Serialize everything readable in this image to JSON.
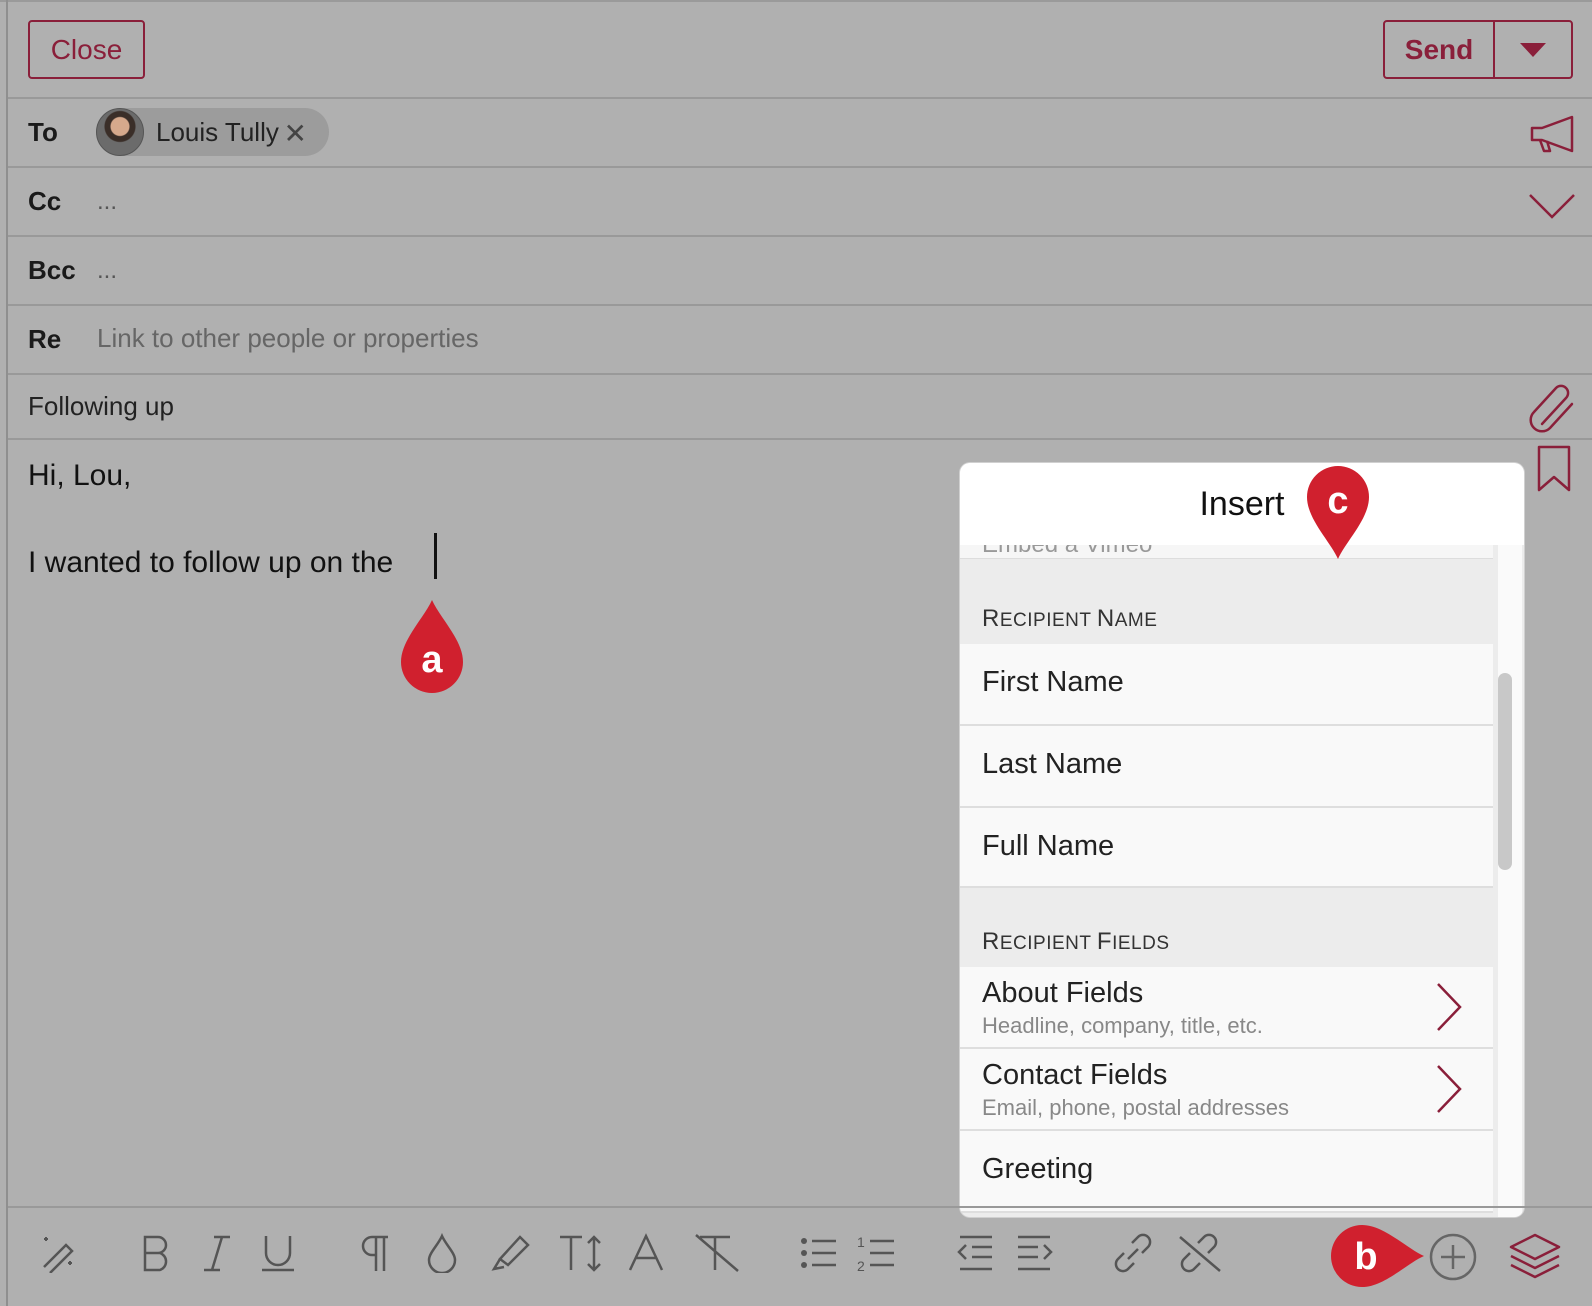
{
  "header": {
    "close_label": "Close",
    "send_label": "Send"
  },
  "fields": {
    "to_label": "To",
    "cc_label": "Cc",
    "bcc_label": "Bcc",
    "re_label": "Re",
    "cc_value": "...",
    "bcc_value": "...",
    "re_placeholder": "Link to other people or properties",
    "recipient": {
      "name": "Louis Tully"
    }
  },
  "subject": "Following up",
  "body": {
    "greeting": "Hi, Lou,",
    "line1": "I wanted to follow up on the "
  },
  "markers": {
    "a": "a",
    "b": "b",
    "c": "c"
  },
  "insert_popover": {
    "title": "Insert",
    "cutoff_item": "Embed a Vimeo",
    "sections": [
      {
        "heading_first": "R",
        "heading_rest": "ECIPIENT ",
        "heading_first2": "N",
        "heading_rest2": "AME"
      },
      {
        "heading_first": "R",
        "heading_rest": "ECIPIENT ",
        "heading_first2": "F",
        "heading_rest2": "IELDS"
      }
    ],
    "items": [
      {
        "title": "First Name"
      },
      {
        "title": "Last Name"
      },
      {
        "title": "Full Name"
      },
      {
        "title": "About Fields",
        "subtitle": "Headline, company, title, etc."
      },
      {
        "title": "Contact Fields",
        "subtitle": "Email, phone, postal addresses"
      },
      {
        "title": "Greeting"
      }
    ]
  },
  "colors": {
    "accent": "#8a1f3a",
    "marker": "#d0202e",
    "background": "#b0b0b0"
  },
  "toolbar_icons": [
    "magic-pen",
    "bold",
    "italic",
    "underline",
    "paragraph",
    "color-drop",
    "highlighter",
    "text-size",
    "font",
    "clear-format",
    "bullet-list",
    "numbered-list",
    "outdent",
    "indent",
    "link",
    "unlink",
    "insert-plus",
    "layers"
  ]
}
